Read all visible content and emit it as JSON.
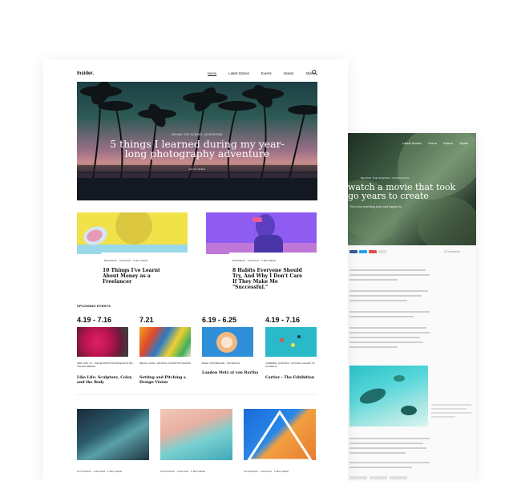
{
  "main": {
    "logo": "Insider.",
    "nav": [
      "Home",
      "Latest Stories",
      "Events",
      "Videos",
      "Styles"
    ],
    "hero": {
      "kicker": "BEHIND THE SCENES, INTERVIEWS",
      "title": "5 things I learned during my year-long photography adventure",
      "label": "FEATURED"
    },
    "cards": [
      {
        "meta": "BUSINESS · 4/26/2019 · 5 MIN READ",
        "title": "10 Things I've Learnt About Money as a Freelancer"
      },
      {
        "meta": "BUSINESS · 4/26/2019 · 5 MIN READ",
        "title": "8 Habits Everyone Should Try, And Why I Don't Care If They Make Me \"Successful.\""
      }
    ],
    "events_heading": "UPCOMING EVENTS",
    "events": [
      {
        "date": "4.19 - 7.16",
        "location": "NEW YORK, US · THE METROPOLITAN MUSEUM OF ART - THE MET BREUER",
        "title": "Like Life: Sculpture, Color, and the Body"
      },
      {
        "date": "7.21",
        "location": "BEIJING, CHINA · NATIONAL CONVENTION CENTER",
        "title": "Setting and Pitching a Design Vision"
      },
      {
        "date": "6.19 - 6.25",
        "location": "BASEL, SWITZERLAND · VON BARTHA",
        "title": "Landon Metz at von Bartha"
      },
      {
        "date": "4.19 - 7.16",
        "location": "CANBERRA, AUSTRALIA · NATIONAL GALLERY OF AUSTRALIA",
        "title": "Cartier - The Exhibition"
      }
    ],
    "bottom_meta": [
      "OUTDOORS · 4/26/2019 · 5 MIN READ",
      "OUTDOORS · 4/26/2019 · 5 MIN READ",
      "OUTDOORS · 4/26/2019 · 5 MIN READ"
    ]
  },
  "secondary": {
    "nav": [
      "Latest Stories",
      "Home",
      "Videos",
      "Styles"
    ],
    "kicker": "BEHIND THE SCENES, INTERVIEWS",
    "title": "watch a movie that took go years to create",
    "subtitle": "This is the best thing that could happen to",
    "comments": "5 Comments"
  },
  "colors": {
    "card1_bg": "#f2e24a",
    "card2_bg": "#8e5cf0",
    "event_teal": "#29b9c9"
  }
}
